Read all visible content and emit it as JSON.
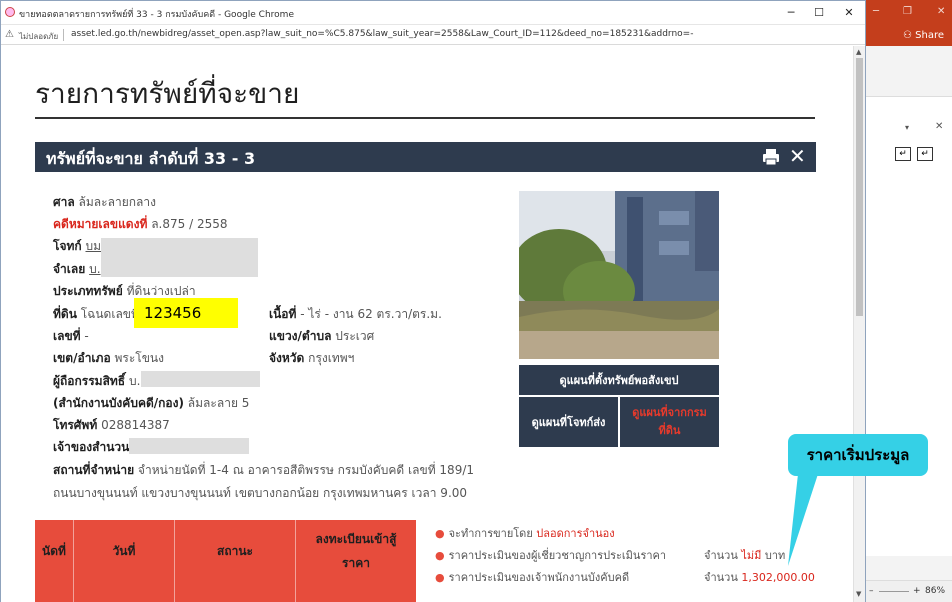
{
  "browser": {
    "title": "ขายทอดตลาดรายการทรัพย์ที่ 33 - 3 กรมบังคับคดี - Google Chrome",
    "not_secure": "ไม่ปลอดภัย",
    "url": "asset.led.go.th/newbidreg/asset_open.asp?law_suit_no=%C5.875&law_suit_year=2558&Law_Court_ID=112&deed_no=185231&addrno=-",
    "zoom": "86%"
  },
  "side_app": {
    "share_label": "Share"
  },
  "page": {
    "heading": "รายการทรัพย์ที่จะขาย",
    "bar_title": "ทรัพย์ที่จะขาย ลำดับที่ 33 - 3"
  },
  "details": {
    "court_label": "ศาล",
    "court_value": "ล้มละลายกลาง",
    "case_label": "คดีหมายเลขแดงที่",
    "case_value": "ล.875 / 2558",
    "plaintiff_label": "โจทก์",
    "plaintiff_value": "บม",
    "defendant_label": "จำเลย",
    "defendant_value": "บ.",
    "asset_type_label": "ประเภททรัพย์",
    "asset_type_value": "ที่ดินว่างเปล่า",
    "land_label": "ที่ดิน",
    "land_value": "โฉนดเลขที่",
    "deed_highlight": "123456",
    "area_label": "เนื้อที่",
    "area_value": "- ไร่ - งาน 62 ตร.วา/ตร.ม.",
    "number_label": "เลขที่",
    "number_value": "-",
    "subdistrict_label": "แขวง/ตำบล",
    "subdistrict_value": "ประเวศ",
    "district_label": "เขต/อำเภอ",
    "district_value": "พระโขนง",
    "province_label": "จังหวัด",
    "province_value": "กรุงเทพฯ",
    "owner_label": "ผู้ถือกรรมสิทธิ์",
    "owner_value": "บ.",
    "office_label": "(สำนักงานบังคับคดี/กอง)",
    "office_value": "ล้มละลาย 5",
    "phone_label": "โทรศัพท์",
    "phone_value": "028814387",
    "officer_label": "เจ้าของสำนวน",
    "officer_value": "",
    "place_label": "สถานที่จำหน่าย",
    "place_line1": "จำหน่ายนัดที่ 1-4 ณ อาคารอสีติพรรษ กรมบังคับคดี เลขที่ 189/1",
    "place_line2": "ถนนบางขุนนนท์ แขวงบางขุนนนท์ เขตบางกอกน้อย กรุงเทพมหานคร เวลา 9.00"
  },
  "map_buttons": {
    "street_map": "ดูแผนที่ตั้งทรัพย์พอสังเขป",
    "plaintiff_map": "ดูแผนที่โจทก์ส่ง",
    "land_dept_map_1": "ดูแผนที่จากกรม",
    "land_dept_map_2": "ที่ดิน"
  },
  "callout": "ราคาเริ่มประมูล",
  "table": {
    "headers": [
      "นัดที่",
      "วันที่",
      "สถานะ",
      "ลงทะเบียนเข้าสู้",
      "ราคา"
    ]
  },
  "bullets": [
    {
      "text": "จะทำการขายโดย ",
      "red": "ปลอดการจำนอง"
    },
    {
      "text": "ราคาประเมินของผู้เชี่ยวชาญการประเมินราคา",
      "red": ""
    },
    {
      "text": "ราคาประเมินของเจ้าพนักงานบังคับคดี",
      "red": ""
    }
  ],
  "amounts": [
    {
      "label": "จำนวน ",
      "value": "ไม่มี",
      "unit": " บาท"
    },
    {
      "label": "จำนวน ",
      "value": "1,302,000.00",
      "unit": ""
    }
  ],
  "colors": {
    "header_bar": "#2e3b4e",
    "red_accent": "#d9261c",
    "table_red": "#e74c3c",
    "callout": "#35d0e6",
    "highlight": "#ffff00"
  }
}
